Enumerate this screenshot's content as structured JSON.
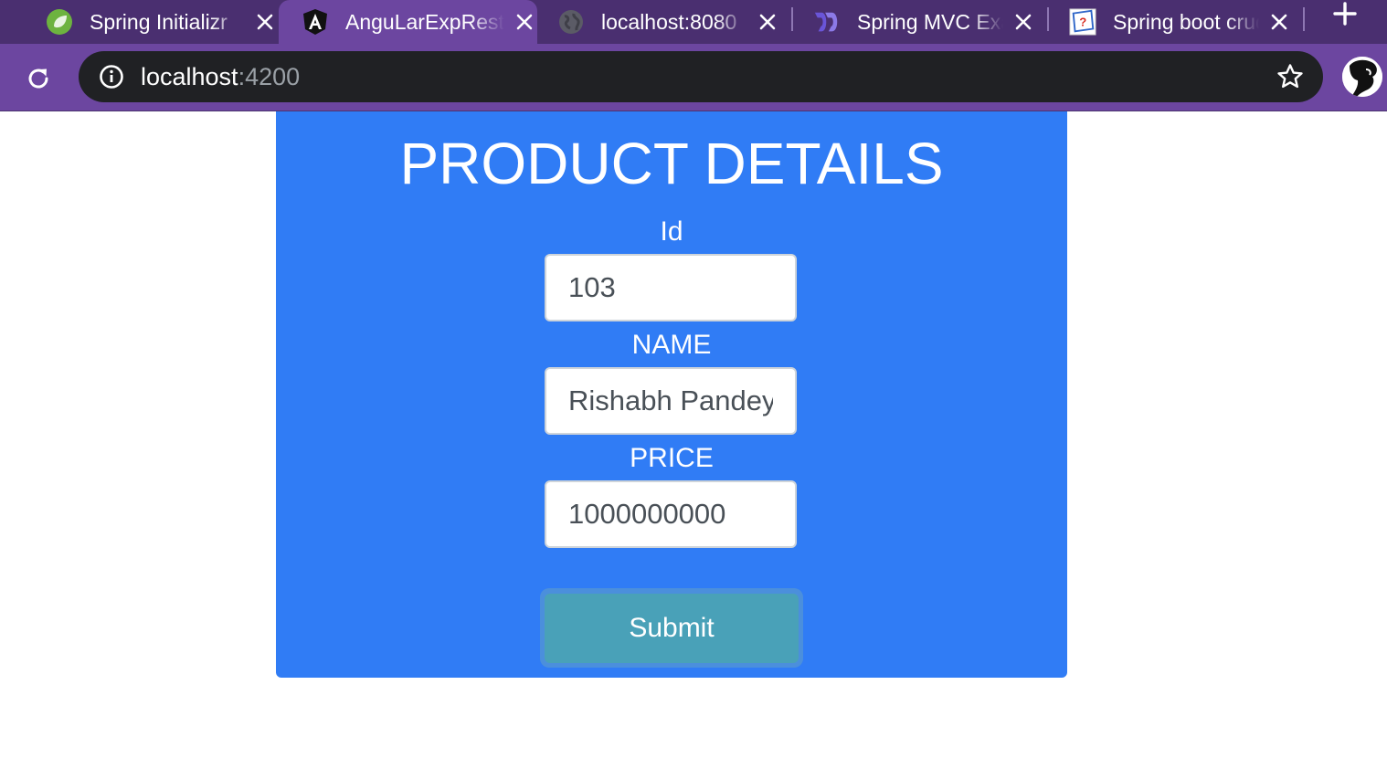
{
  "browser": {
    "tabs": [
      {
        "title": "Spring Initializr",
        "icon": "spring-leaf-icon"
      },
      {
        "title": "AnguLarExpRest",
        "icon": "angular-icon",
        "active": true
      },
      {
        "title": "localhost:8080",
        "icon": "globe-icon"
      },
      {
        "title": "Spring MVC Example",
        "icon": "dbeaver-icon"
      },
      {
        "title": "Spring boot crud",
        "icon": "document-icon"
      }
    ],
    "address": {
      "host": "localhost",
      "port": ":4200"
    },
    "colors": {
      "tab_strip": "#4a2f70",
      "toolbar": "#6c46a0",
      "omnibox": "#202124"
    }
  },
  "page": {
    "title": "PRODUCT DETAILS",
    "fields": {
      "id": {
        "label": "Id",
        "value": "103"
      },
      "name": {
        "label": "NAME",
        "value": "Rishabh Pandey"
      },
      "price": {
        "label": "PRICE",
        "value": "1000000000"
      }
    },
    "submit_label": "Submit",
    "colors": {
      "card": "#307cf5",
      "button": "#49a1b8"
    }
  }
}
